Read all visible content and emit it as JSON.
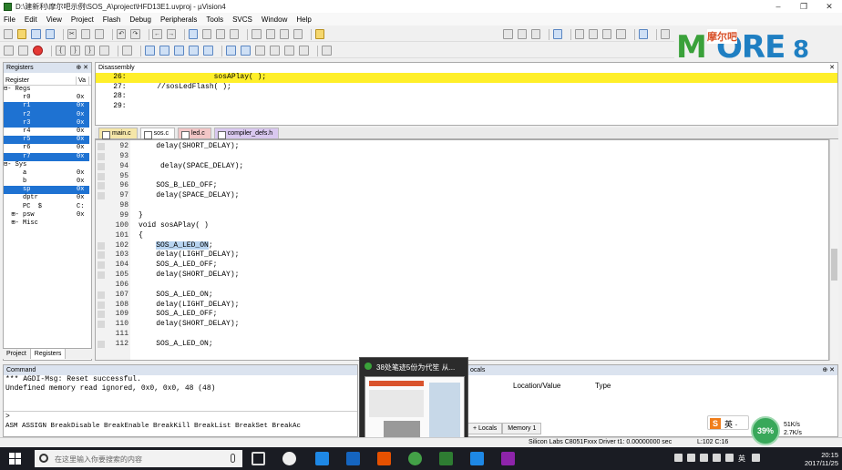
{
  "window": {
    "title": "D:\\建新利\\摩尔吧示例\\SOS_A\\project\\HFD13E1.uvproj - µVision4",
    "controls": [
      "–",
      "❐",
      "✕"
    ]
  },
  "menu": [
    "File",
    "Edit",
    "View",
    "Project",
    "Flash",
    "Debug",
    "Peripherals",
    "Tools",
    "SVCS",
    "Window",
    "Help"
  ],
  "logo": {
    "brand_left": "M",
    "brand_mid": "ORE",
    "cn": "摩尔吧",
    "num": "8"
  },
  "registers": {
    "title": "Registers",
    "col_register": "Register",
    "col_value": "Va",
    "rows": [
      {
        "name": "⊟- Regs",
        "value": "",
        "sel": false
      },
      {
        "name": "     r0",
        "value": "0x",
        "sel": false
      },
      {
        "name": "     r1",
        "value": "0x",
        "sel": true
      },
      {
        "name": "     r2",
        "value": "0x",
        "sel": true
      },
      {
        "name": "     r3",
        "value": "0x",
        "sel": true
      },
      {
        "name": "     r4",
        "value": "0x",
        "sel": false
      },
      {
        "name": "     r5",
        "value": "0x",
        "sel": true
      },
      {
        "name": "     r6",
        "value": "0x",
        "sel": false
      },
      {
        "name": "     r7",
        "value": "0x",
        "sel": true
      },
      {
        "name": "⊟- Sys",
        "value": "",
        "sel": false
      },
      {
        "name": "     a",
        "value": "0x",
        "sel": false
      },
      {
        "name": "     b",
        "value": "0x",
        "sel": false
      },
      {
        "name": "     sp",
        "value": "0x",
        "sel": true
      },
      {
        "name": "     dptr",
        "value": "0x",
        "sel": false
      },
      {
        "name": "     PC  $",
        "value": "C:",
        "sel": false
      },
      {
        "name": "  ⊞- psw",
        "value": "0x",
        "sel": false
      },
      {
        "name": "  ⊞- Misc",
        "value": "",
        "sel": false
      }
    ],
    "tabs": [
      "Project",
      "Registers"
    ]
  },
  "disassembly": {
    "title": "Disassembly",
    "lines": [
      {
        "text": "    26:                    sosAPlay( );",
        "hl": true
      },
      {
        "text": "    27:       //sosLedFlash( );",
        "hl": false
      },
      {
        "text": "    28:",
        "hl": false
      },
      {
        "text": "    29:",
        "hl": false
      }
    ]
  },
  "file_tabs": [
    {
      "label": "main.c",
      "active": false,
      "color": "#f5e6a8"
    },
    {
      "label": "sos.c",
      "active": true,
      "color": "#f5e6a8"
    },
    {
      "label": "led.c",
      "active": false,
      "color": "#f2c6c6"
    },
    {
      "label": "compiler_defs.h",
      "active": false,
      "color": "#d9c8ef"
    }
  ],
  "editor": {
    "lines": [
      {
        "n": "92",
        "code": "    delay(SHORT_DELAY);",
        "mark": true
      },
      {
        "n": "93",
        "code": "",
        "mark": true
      },
      {
        "n": "94",
        "code": "     delay(SPACE_DELAY);",
        "mark": true
      },
      {
        "n": "95",
        "code": "",
        "mark": true
      },
      {
        "n": "96",
        "code": "    SOS_B_LED_OFF;",
        "mark": true
      },
      {
        "n": "97",
        "code": "    delay(SPACE_DELAY);",
        "mark": true
      },
      {
        "n": "98",
        "code": "",
        "mark": false
      },
      {
        "n": "99",
        "code": "}",
        "mark": false
      },
      {
        "n": "100",
        "code": "void sosAPlay( )",
        "mark": false
      },
      {
        "n": "101",
        "code": "{",
        "mark": false
      },
      {
        "n": "102",
        "code": "    SOS_A_LED_ON;",
        "mark": true,
        "sel": true
      },
      {
        "n": "103",
        "code": "    delay(LIGHT_DELAY);",
        "mark": true
      },
      {
        "n": "104",
        "code": "    SOS_A_LED_OFF;",
        "mark": true
      },
      {
        "n": "105",
        "code": "    delay(SHORT_DELAY);",
        "mark": true
      },
      {
        "n": "106",
        "code": "",
        "mark": false
      },
      {
        "n": "107",
        "code": "    SOS_A_LED_ON;",
        "mark": true
      },
      {
        "n": "108",
        "code": "    delay(LIGHT_DELAY);",
        "mark": true
      },
      {
        "n": "109",
        "code": "    SOS_A_LED_OFF;",
        "mark": true
      },
      {
        "n": "110",
        "code": "    delay(SHORT_DELAY);",
        "mark": true
      },
      {
        "n": "111",
        "code": "",
        "mark": false
      },
      {
        "n": "112",
        "code": "    SOS_A_LED_ON;",
        "mark": true
      }
    ]
  },
  "command": {
    "title": "Command",
    "lines": [
      "*** AGDI-Msg: Reset successful.",
      "Undefined memory read ignored, 0x0, 0x0, 48 (48)"
    ],
    "prompt": ">",
    "help": "ASM ASSIGN BreakDisable BreakEnable BreakKill BreakList BreakSet BreakAc"
  },
  "locals": {
    "title": "ocals",
    "col_location": "Location/Value",
    "col_type": "Type",
    "tabs": [
      "+ Locals",
      "Memory 1"
    ]
  },
  "popup": {
    "title": "38处笔迹5份为代笙 从..."
  },
  "status": {
    "target": "Silicon Labs C8051Fxxx Driver  t1: 0.00000000 sec",
    "pos": "L:102 C:16"
  },
  "ime": {
    "logo": "S",
    "text": "英 ·"
  },
  "net": {
    "percent": "39%",
    "up": "51K/s",
    "down": "2.7K/s"
  },
  "taskbar": {
    "search_placeholder": "在这里输入你要搜索的内容",
    "lang": "英",
    "time": "20:15",
    "date": "2017/11/25"
  }
}
